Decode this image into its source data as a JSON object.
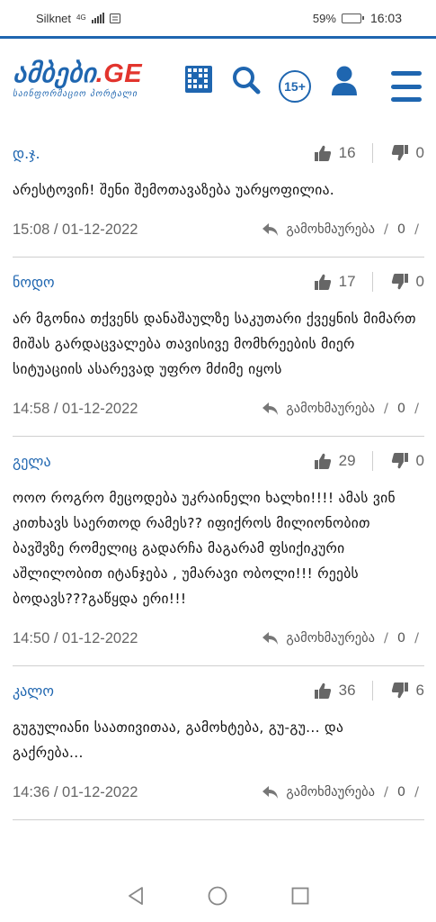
{
  "status_bar": {
    "carrier": "Silknet",
    "network": "4G",
    "battery": "59%",
    "battery_level": 0.59,
    "time": "16:03"
  },
  "header": {
    "logo_text": "ამბები",
    "logo_suffix": ".GE",
    "tagline": "საინფორმაციო პორტალი",
    "age_rating": "15+",
    "brand_color": "#1f66b0",
    "accent_color": "#e2342d",
    "icons": [
      "grid-icon",
      "search-icon",
      "user-icon",
      "menu-icon"
    ]
  },
  "comments": [
    {
      "author": "დ.ჯ.",
      "likes": "16",
      "dislikes": "0",
      "text": "არესტოვიჩ! შენი შემოთავაზება უარყოფილია.",
      "timestamp": "15:08 / 01-12-2022",
      "reply_label": "გამოხმაურება",
      "reply_count": "0"
    },
    {
      "author": "ნოდო",
      "likes": "17",
      "dislikes": "0",
      "text": "არ მგონია თქვენს დანაშაულზე საკუთარი ქვეყნის მიმართ მიშას გარდაცვალება თავისივე მომხრეების მიერ სიტუაციის ასარევად უფრო მძიმე იყოს",
      "timestamp": "14:58 / 01-12-2022",
      "reply_label": "გამოხმაურება",
      "reply_count": "0"
    },
    {
      "author": "გელა",
      "likes": "29",
      "dislikes": "0",
      "text": "ოოო როგრო მეცოდება უკრაინელი ხალხი!!!! ამას ვინ კითხავს საერთოდ რამეს?? იფიქროს მილიონობით ბავშვზე რომელიც გადარჩა მაგარამ ფსიქიკური აშლილობით იტანჯება , უმარავი ობოლი!!! რეებს ბოდავს???გაწყდა ერი!!!",
      "timestamp": "14:50 / 01-12-2022",
      "reply_label": "გამოხმაურება",
      "reply_count": "0"
    },
    {
      "author": "კალო",
      "likes": "36",
      "dislikes": "6",
      "text": "გუგულიანი საათივითაა, გამოხტება, გუ-გუ... და გაქრება...",
      "timestamp": "14:36 / 01-12-2022",
      "reply_label": "გამოხმაურება",
      "reply_count": "0"
    }
  ],
  "nav_bar": {
    "buttons": [
      "back-icon",
      "home-icon",
      "recents-icon"
    ]
  }
}
